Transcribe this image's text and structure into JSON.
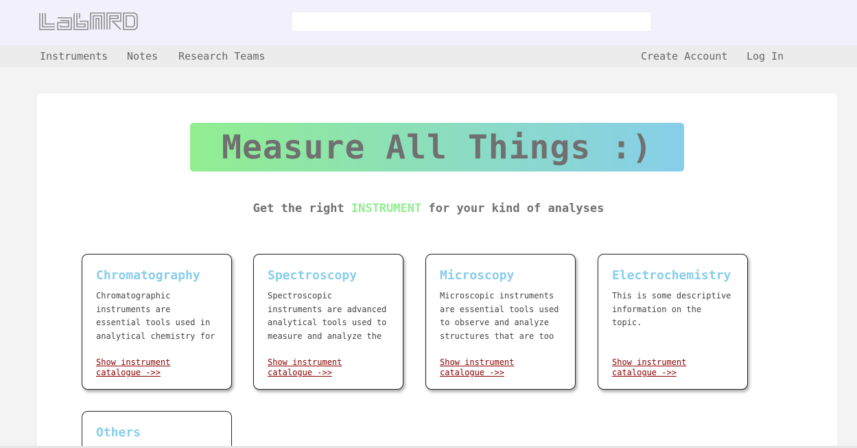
{
  "header": {
    "logo_text": "LabNrd",
    "search": {
      "value": "",
      "placeholder": ""
    }
  },
  "nav": {
    "left": [
      "Instruments",
      "Notes",
      "Research Teams"
    ],
    "right": [
      "Create Account",
      "Log In"
    ]
  },
  "hero": {
    "title": "Measure All Things :)",
    "subtitle_pre": "Get the right ",
    "subtitle_highlight": "INSTRUMENT",
    "subtitle_post": " for your kind of analyses"
  },
  "categories": [
    {
      "title": "Chromatography",
      "description": "Chromatographic instruments are essential tools used in analytical chemistry for separating and identifying",
      "link": "Show instrument catalogue ->>"
    },
    {
      "title": "Spectroscopy",
      "description": "Spectroscopic instruments are advanced analytical tools used to measure and analyze the interaction of light",
      "link": "Show instrument catalogue ->>"
    },
    {
      "title": "Microscopy",
      "description": "Microscopic instruments are essential tools used to observe and analyze structures that are too small to be seen with",
      "link": "Show instrument catalogue ->>"
    },
    {
      "title": "Electrochemistry",
      "description": "This is some descriptive information on the topic.",
      "link": "Show instrument catalogue ->>"
    }
  ],
  "others": {
    "title": "Others"
  },
  "colors": {
    "accent_green": "#90ee90",
    "accent_blue": "#87ceeb",
    "link": "#8b0000"
  }
}
